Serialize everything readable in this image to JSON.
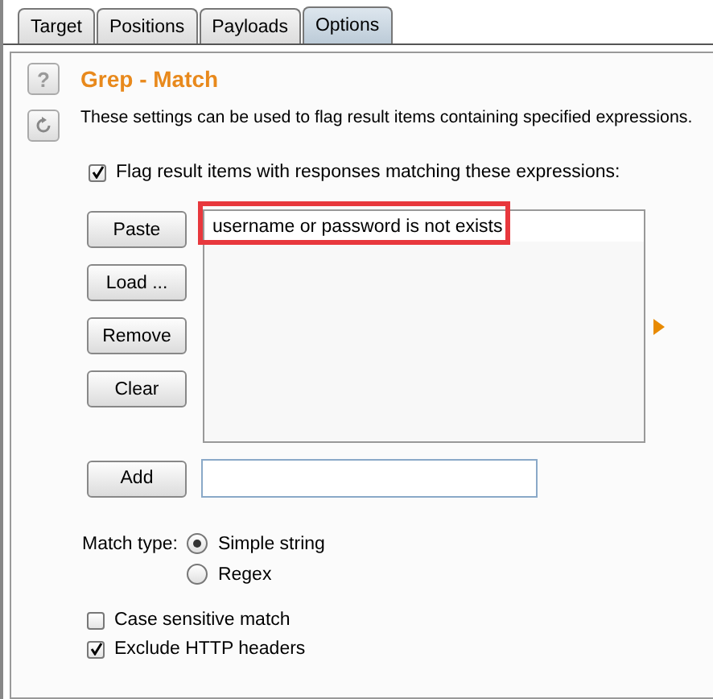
{
  "tabs": [
    {
      "label": "Target",
      "selected": false
    },
    {
      "label": "Positions",
      "selected": false
    },
    {
      "label": "Payloads",
      "selected": false
    },
    {
      "label": "Options",
      "selected": true
    }
  ],
  "section": {
    "help_icon": "?",
    "title": "Grep - Match",
    "description": "These settings can be used to flag result items containing specified expressions."
  },
  "flag_checkbox": {
    "label": "Flag result items with responses matching these expressions:",
    "checked": true
  },
  "list_buttons": [
    "Paste",
    "Load ...",
    "Remove",
    "Clear"
  ],
  "expressions": [
    {
      "text": "username or password is not exists",
      "highlighted": true
    }
  ],
  "add_button": "Add",
  "match_type": {
    "label": "Match type:",
    "options": [
      {
        "label": "Simple string",
        "selected": true
      },
      {
        "label": "Regex",
        "selected": false
      }
    ]
  },
  "options": [
    {
      "label": "Case sensitive match",
      "checked": false
    },
    {
      "label": "Exclude HTTP headers",
      "checked": true
    }
  ]
}
